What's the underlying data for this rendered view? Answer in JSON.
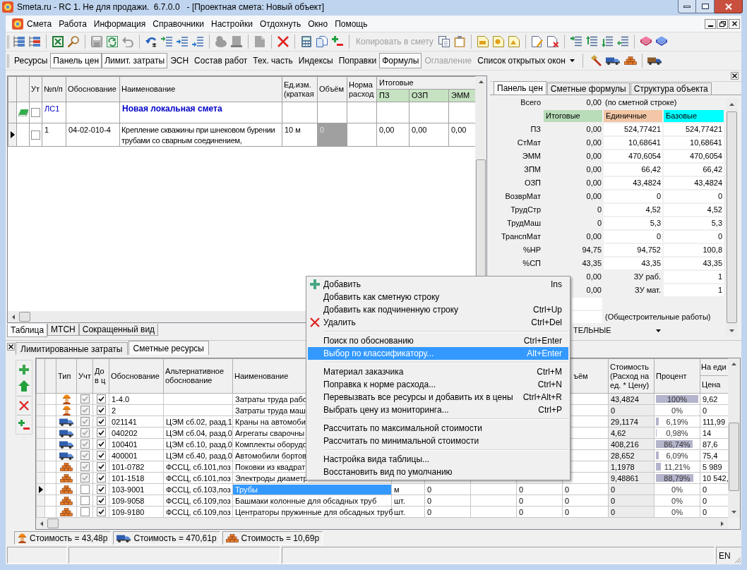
{
  "window": {
    "title": "Smeta.ru - RC 1. Не для продажи.  6.7.0.0   - [Проектная смета: Новый объект]"
  },
  "menu": [
    {
      "label": "Смета"
    },
    {
      "label": "Работа"
    },
    {
      "label": "Информация"
    },
    {
      "label": "Справочники"
    },
    {
      "label": "Настройки"
    },
    {
      "label": "Отдохнуть"
    },
    {
      "label": "Окно"
    },
    {
      "label": "Помощь"
    }
  ],
  "toolbar": {
    "copy_button": {
      "label": "Копировать в смету",
      "disabled": true
    }
  },
  "view_bar": [
    {
      "label": "Ресурсы",
      "kind": "toggle",
      "selected": false,
      "disabled": false
    },
    {
      "label": "Панель цен",
      "kind": "toggle",
      "selected": true,
      "disabled": false
    },
    {
      "label": "Лимит. затраты",
      "kind": "toggle",
      "selected": true,
      "disabled": false
    },
    {
      "label": "ЭСН",
      "kind": "toggle",
      "selected": false,
      "disabled": false
    },
    {
      "label": "Состав работ",
      "kind": "toggle",
      "selected": false,
      "disabled": false
    },
    {
      "label": "Тех. часть",
      "kind": "toggle",
      "selected": false,
      "disabled": false
    },
    {
      "label": "Индексы",
      "kind": "toggle",
      "selected": false,
      "disabled": false
    },
    {
      "label": "Поправки",
      "kind": "toggle",
      "selected": false,
      "disabled": false
    },
    {
      "label": "Формулы",
      "kind": "toggle",
      "selected": true,
      "disabled": false
    },
    {
      "label": "Оглавление",
      "kind": "toggle",
      "selected": false,
      "disabled": true
    },
    {
      "label": "Список открытых окон",
      "kind": "dropdown",
      "selected": false,
      "disabled": false
    }
  ],
  "estimate": {
    "columns": [
      {
        "label": "Ут"
      },
      {
        "label": "№п/п"
      },
      {
        "label": "Обоснование"
      },
      {
        "label": "Наименование"
      },
      {
        "label": "Ед.изм.\n(краткая"
      },
      {
        "label": "Объём"
      },
      {
        "label": "Норма\nрасход"
      }
    ],
    "totals": {
      "label": "Итоговые",
      "columns": [
        "ПЗ",
        "ОЗП",
        "ЭММ"
      ]
    },
    "rows": [
      {
        "kind": "section",
        "current": false,
        "checked": false,
        "number": "ЛС1",
        "name": "Новая локальная смета"
      },
      {
        "kind": "position",
        "current": true,
        "checked": false,
        "number": "1",
        "basis": "04-02-010-4",
        "name": "Крепление скважины при шнековом бурении трубами со сварным соединением,",
        "unit": "10 м",
        "volume": "0",
        "totals": [
          "0,00",
          "0,00",
          "0,00"
        ]
      }
    ],
    "tabs": [
      {
        "label": "Таблица",
        "selected": true
      },
      {
        "label": "МТСН",
        "selected": false
      },
      {
        "label": "Сокращенный вид",
        "selected": false
      }
    ]
  },
  "price_panel": {
    "tabs": [
      {
        "label": "Панель цен",
        "selected": true
      },
      {
        "label": "Сметные формулы",
        "selected": false
      },
      {
        "label": "Структура объекта",
        "selected": false
      }
    ],
    "total": {
      "label": "Всего",
      "value": "0,00",
      "note": "(по сметной строке)"
    },
    "columns": [
      "Итоговые",
      "Единичные",
      "Базовые"
    ],
    "rows": [
      {
        "kind": "value",
        "label": "ПЗ",
        "total": "0,00",
        "unit": "524,77421",
        "base": "524,77421"
      },
      {
        "kind": "value",
        "label": "СтМат",
        "total": "0,00",
        "unit": "10,68641",
        "base": "10,68641"
      },
      {
        "kind": "value",
        "label": "ЭММ",
        "total": "0,00",
        "unit": "470,6054",
        "base": "470,6054"
      },
      {
        "kind": "value",
        "label": "ЗПМ",
        "total": "0,00",
        "unit": "66,42",
        "base": "66,42"
      },
      {
        "kind": "value",
        "label": "ОЗП",
        "total": "0,00",
        "unit": "43,4824",
        "base": "43,4824"
      },
      {
        "kind": "value",
        "label": "ВозврМат",
        "total": "0,00",
        "unit": "0",
        "base": "0"
      },
      {
        "kind": "value",
        "label": "ТрудСтр",
        "total": "0",
        "unit": "4,52",
        "base": "4,52"
      },
      {
        "kind": "value",
        "label": "ТрудМаш",
        "total": "0",
        "unit": "5,3",
        "base": "5,3"
      },
      {
        "kind": "value",
        "label": "ТранспМат",
        "total": "0,00",
        "unit": "0",
        "base": "0"
      },
      {
        "kind": "value",
        "label": "%НР",
        "total": "94,75",
        "unit": "94,752",
        "base": "100,8"
      },
      {
        "kind": "value",
        "label": "%СП",
        "total": "43,35",
        "unit": "43,35",
        "base": "43,35"
      },
      {
        "kind": "coefficient",
        "total": "0,00",
        "name": "ЗУ раб.",
        "base": "1"
      },
      {
        "kind": "coefficient",
        "total": "0,00",
        "name": "ЗУ мат.",
        "base": "1"
      }
    ],
    "work_type_note": "(Общестроительные работы)",
    "category": {
      "value": "ТЕЛЬНЫЕ"
    }
  },
  "resources": {
    "tabs": [
      {
        "label": "Лимитированные затраты",
        "selected": false
      },
      {
        "label": "Сметные ресурсы",
        "selected": true
      }
    ],
    "columns": {
      "type": "Тип",
      "accounted": "Учт",
      "contract": "До\nв ц",
      "code": "Обоснование",
      "alt_code": "Альтернативное\nобоснование",
      "name": "Наименование",
      "volume": "ъём",
      "cost": "Стоимость\n(Расход на\nед. * Цену)",
      "percent": "Процент",
      "per_unit": "На еди",
      "price": "Цена"
    },
    "rows": [
      {
        "kind": "labor",
        "selected": false,
        "accounted": true,
        "contract": true,
        "code": "1-4.0",
        "name": "Затраты труда рабо",
        "cost": "43,4824",
        "percent": "100%",
        "level": 1,
        "price": "9,62"
      },
      {
        "kind": "labor",
        "selected": false,
        "accounted": true,
        "contract": true,
        "code": "2",
        "name": "Затраты труда маш",
        "cost": "0",
        "percent": "0%",
        "price": "0"
      },
      {
        "kind": "machine",
        "selected": false,
        "accounted": true,
        "contract": true,
        "code": "021141",
        "alt_code": "ЦЭМ сб.02, разд.1",
        "name": "Краны на автомоби",
        "cost": "29,1174",
        "percent": "6,19%",
        "level": 0.0619,
        "price": "111,99"
      },
      {
        "kind": "machine",
        "selected": false,
        "accounted": true,
        "contract": true,
        "code": "040202",
        "alt_code": "ЦЭМ сб.04, разд.0",
        "name": "Агрегаты сварочны",
        "cost": "4,62",
        "percent": "0,98%",
        "level": 0.0098,
        "price": "14"
      },
      {
        "kind": "machine",
        "selected": false,
        "accounted": true,
        "contract": true,
        "code": "100401",
        "alt_code": "ЦЭМ сб.10, разд.0",
        "name": "Комплекты оборудо",
        "cost": "408,216",
        "percent": "86,74%",
        "level": 0.8674,
        "price": "87,6"
      },
      {
        "kind": "machine",
        "selected": false,
        "accounted": true,
        "contract": true,
        "code": "400001",
        "alt_code": "ЦЭМ сб.40, разд.0",
        "name": "Автомобили бортов",
        "cost": "28,652",
        "percent": "6,09%",
        "level": 0.0609,
        "price": "75,4"
      },
      {
        "kind": "material",
        "selected": false,
        "accounted": true,
        "contract": true,
        "code": "101-0782",
        "alt_code": "ФССЦ, сб.101,поз",
        "name": "Поковки из квадрат",
        "cost": "1,1978",
        "percent": "11,21%",
        "level": 0.1121,
        "price": "5 989"
      },
      {
        "kind": "material",
        "selected": false,
        "accounted": true,
        "contract": true,
        "code": "101-1518",
        "alt_code": "ФССЦ, сб.101,поз",
        "name": "Электроды диаметр",
        "cost": "9,48861",
        "percent": "88,79%",
        "level": 0.8879,
        "price": "10 542,"
      },
      {
        "kind": "material",
        "selected": true,
        "accounted": false,
        "contract": true,
        "code": "103-9001",
        "alt_code": "ФССЦ, сб.103,поз",
        "name": "Трубы",
        "column_8": "м",
        "column_9": "0",
        "column_11": "0",
        "volume": "0",
        "cost": "0",
        "percent": "0%",
        "price": "0"
      },
      {
        "kind": "material",
        "selected": false,
        "accounted": false,
        "contract": true,
        "code": "109-9058",
        "alt_code": "ФССЦ, сб.109,поз",
        "name": "Башмаки колонные для обсадных труб",
        "column_8": "шт.",
        "column_9": "0",
        "column_11": "0",
        "volume": "0",
        "cost": "0",
        "percent": "0%",
        "price": "0"
      },
      {
        "kind": "material",
        "selected": false,
        "accounted": false,
        "contract": true,
        "code": "109-9180",
        "alt_code": "ФССЦ, сб.109,поз",
        "name": "Центраторы пружинные для обсадных труб",
        "column_8": "шт.",
        "column_9": "0",
        "column_11": "0",
        "volume": "0",
        "cost": "0",
        "percent": "0%",
        "price": "0"
      }
    ],
    "summary": [
      {
        "kind": "labor",
        "text": "Стоимость = 43,48р"
      },
      {
        "kind": "machine",
        "text": "Стоимость = 470,61р"
      },
      {
        "kind": "material",
        "text": "Стоимость = 10,69р"
      }
    ]
  },
  "context_menu": {
    "groups": [
      {
        "items": [
          {
            "kind": "add",
            "label": "Добавить",
            "shortcut": "Ins",
            "selected": false
          },
          {
            "kind": "plain",
            "label": "Добавить как сметную строку",
            "selected": false
          },
          {
            "kind": "plain",
            "label": "Добавить как подчиненную строку",
            "shortcut": "Ctrl+Up",
            "selected": false
          },
          {
            "kind": "delete",
            "label": "Удалить",
            "shortcut": "Ctrl+Del",
            "selected": false
          }
        ]
      },
      {
        "items": [
          {
            "kind": "plain",
            "label": "Поиск по обоснованию",
            "shortcut": "Ctrl+Enter",
            "selected": false
          },
          {
            "kind": "plain",
            "label": "Выбор по классификатору...",
            "shortcut": "Alt+Enter",
            "selected": true
          }
        ]
      },
      {
        "items": [
          {
            "kind": "plain",
            "label": "Материал заказчика",
            "shortcut": "Ctrl+M",
            "selected": false
          },
          {
            "kind": "plain",
            "label": "Поправка к норме расхода...",
            "shortcut": "Ctrl+N",
            "selected": false
          },
          {
            "kind": "plain",
            "label": "Перевызвать все ресурсы и добавить их в цены",
            "shortcut": "Ctrl+Alt+R",
            "selected": false
          },
          {
            "kind": "plain",
            "label": "Выбрать цену из мониторинга...",
            "shortcut": "Ctrl+P",
            "selected": false
          }
        ]
      },
      {
        "items": [
          {
            "kind": "plain",
            "label": "Рассчитать по максимальной стоимости",
            "selected": false
          },
          {
            "kind": "plain",
            "label": "Рассчитать по минимальной стоимости",
            "selected": false
          }
        ]
      },
      {
        "items": [
          {
            "kind": "plain",
            "label": "Настройка вида таблицы...",
            "selected": false
          },
          {
            "kind": "plain",
            "label": "Восстановить вид по умолчанию",
            "selected": false
          }
        ]
      }
    ]
  },
  "status_bar": {
    "language": "EN"
  }
}
